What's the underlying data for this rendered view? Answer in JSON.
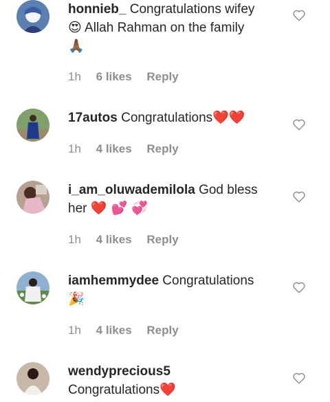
{
  "comments": [
    {
      "username": "honnieb_",
      "text": "Congratulations wifey",
      "emoji1": "😍",
      "text2": "Allah Rahman on the family",
      "emoji2": "🙏🏾",
      "time": "1h",
      "likes": "6 likes",
      "reply": "Reply"
    },
    {
      "username": "17autos",
      "text": "Congratulations",
      "emoji1": "❤️❤️",
      "time": "1h",
      "likes": "4 likes",
      "reply": "Reply"
    },
    {
      "username": "i_am_oluwademilola",
      "text": "God bless",
      "text2": "her",
      "emoji1": "❤️ 💕 💞",
      "time": "1h",
      "likes": "4 likes",
      "reply": "Reply"
    },
    {
      "username": "iamhemmydee",
      "text": "Congratulations",
      "emoji1": "🎉",
      "time": "1h",
      "likes": "4 likes",
      "reply": "Reply"
    },
    {
      "username": "wendyprecious5",
      "text": "Congratulations",
      "emoji1": "❤️",
      "time": "",
      "likes": "",
      "reply": ""
    }
  ],
  "colors": {
    "text": "#262626",
    "meta": "#8e8e8e",
    "emoji_heart": "#e0245e"
  },
  "icons": {
    "like": "heart-outline-icon"
  }
}
